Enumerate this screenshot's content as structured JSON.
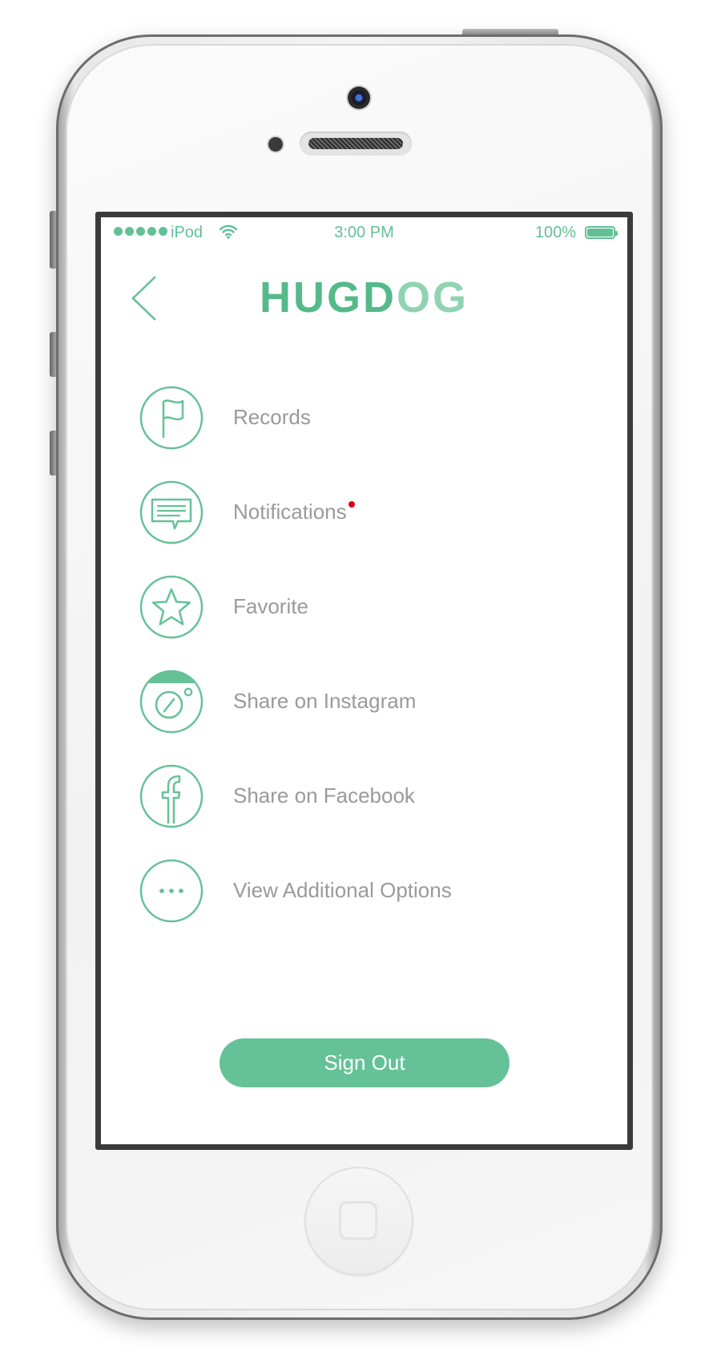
{
  "status_bar": {
    "carrier": "iPod",
    "time": "3:00 PM",
    "battery_percent": "100%",
    "signal_dots": 5,
    "battery_level": 1.0
  },
  "header": {
    "logo_part1": "HUGD",
    "logo_part2": "OG",
    "back_icon": "chevron-left-icon"
  },
  "menu": {
    "items": [
      {
        "label": "Records",
        "icon": "flag-icon",
        "has_badge": false
      },
      {
        "label": "Notifications",
        "icon": "chat-bubble-icon",
        "has_badge": true
      },
      {
        "label": "Favorite",
        "icon": "star-icon",
        "has_badge": false
      },
      {
        "label": "Share on Instagram",
        "icon": "instagram-icon",
        "has_badge": false
      },
      {
        "label": "Share on Facebook",
        "icon": "facebook-icon",
        "has_badge": false
      },
      {
        "label": "View Additional Options",
        "icon": "more-options-icon",
        "has_badge": false
      }
    ]
  },
  "sign_out": {
    "label": "Sign Out"
  },
  "colors": {
    "accent": "#65c197",
    "accent_light": "#8fd3b3",
    "label_gray": "#9a9a9a",
    "badge_red": "#d8001e",
    "screen_bezel": "#3b3b3b"
  }
}
